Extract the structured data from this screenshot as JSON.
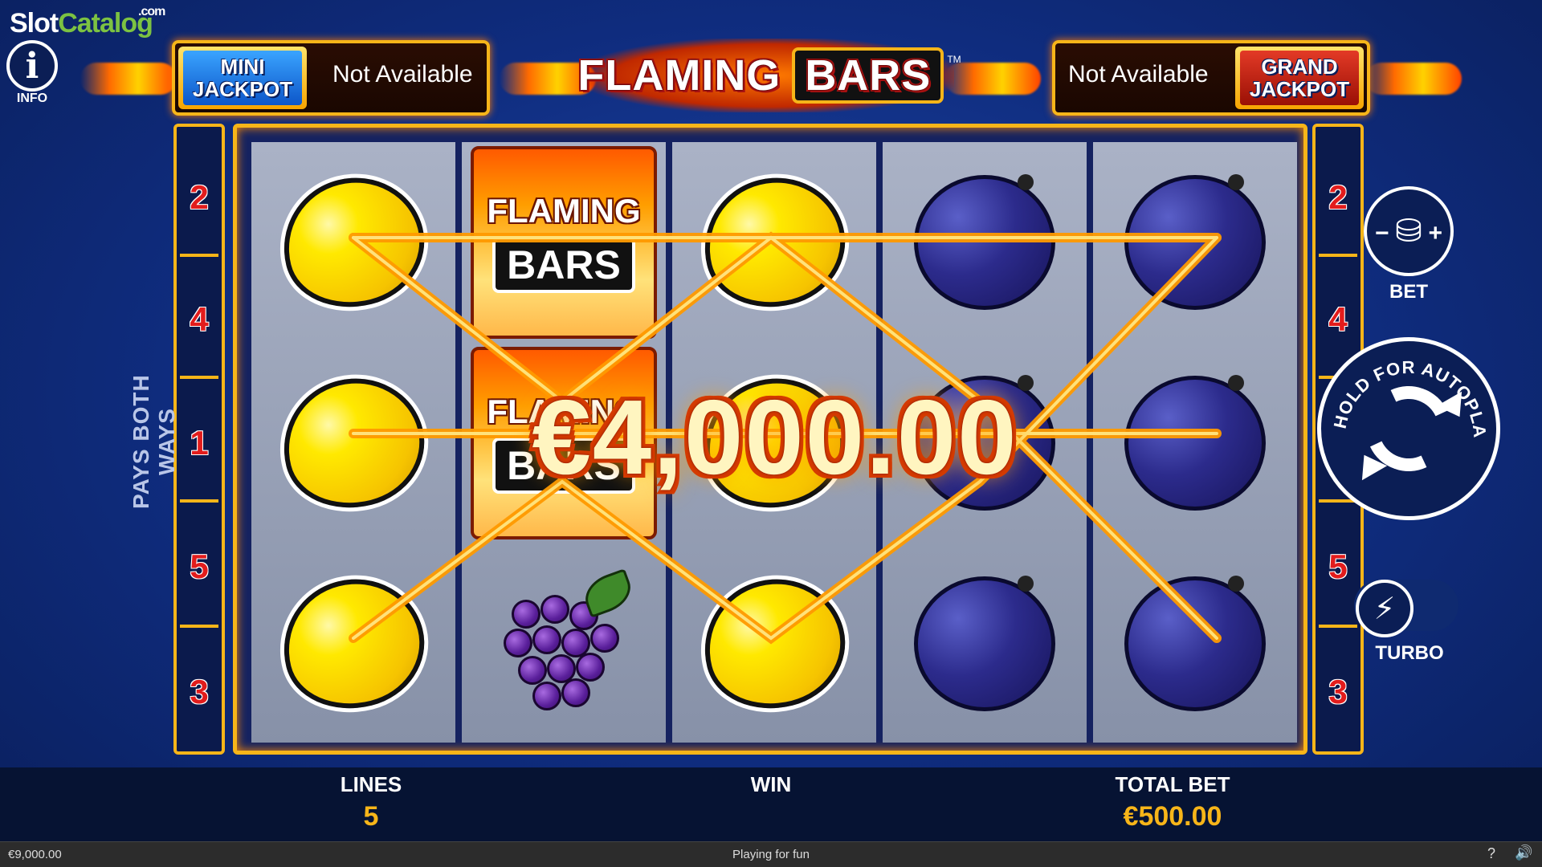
{
  "watermark": {
    "part_a": "Slot",
    "part_b": "Catalog",
    "suffix": ".com"
  },
  "info": {
    "icon": "info-icon",
    "label": "INFO"
  },
  "header": {
    "mini_jackpot": {
      "line1": "MINI",
      "line2": "JACKPOT",
      "value": "Not Available"
    },
    "logo": {
      "word1": "FLAMING",
      "word2": "BARS",
      "tm": "TM"
    },
    "grand_jackpot": {
      "line1": "GRAND",
      "line2": "JACKPOT",
      "value": "Not Available"
    }
  },
  "paylines": {
    "left": [
      "2",
      "4",
      "1",
      "5",
      "3"
    ],
    "right": [
      "2",
      "4",
      "1",
      "5",
      "3"
    ],
    "pays_both_ways": "PAYS BOTH WAYS"
  },
  "reels": [
    [
      "lemon",
      "lemon",
      "lemon"
    ],
    [
      "flaming-bars",
      "flaming-bars",
      "grapes"
    ],
    [
      "lemon",
      "lemon",
      "lemon"
    ],
    [
      "plum",
      "plum",
      "plum"
    ],
    [
      "plum",
      "plum",
      "plum"
    ]
  ],
  "symbols": {
    "bar_word1": "FLAMING",
    "bar_word2": "BARS"
  },
  "win_display": "€4,000.00",
  "controls": {
    "bet": {
      "icon": "coin-stack-icon",
      "label": "BET"
    },
    "autoplay": {
      "icon": "autoplay-icon",
      "label": "HOLD FOR AUTOPLAY"
    },
    "turbo": {
      "icon": "lightning-bolt-icon",
      "label": "TURBO"
    }
  },
  "bottom": {
    "lines_label": "LINES",
    "lines_value": "5",
    "win_label": "WIN",
    "win_value": "",
    "total_bet_label": "TOTAL BET",
    "total_bet_value": "€500.00"
  },
  "status": {
    "balance": "€9,000.00",
    "mode": "Playing for fun",
    "help_icon": "?",
    "sound_icon": "speaker-icon"
  },
  "colors": {
    "gold": "#f7b519",
    "line_red": "#e21c1c",
    "background": "#0f2c7e",
    "payline": "#ff9a00"
  }
}
